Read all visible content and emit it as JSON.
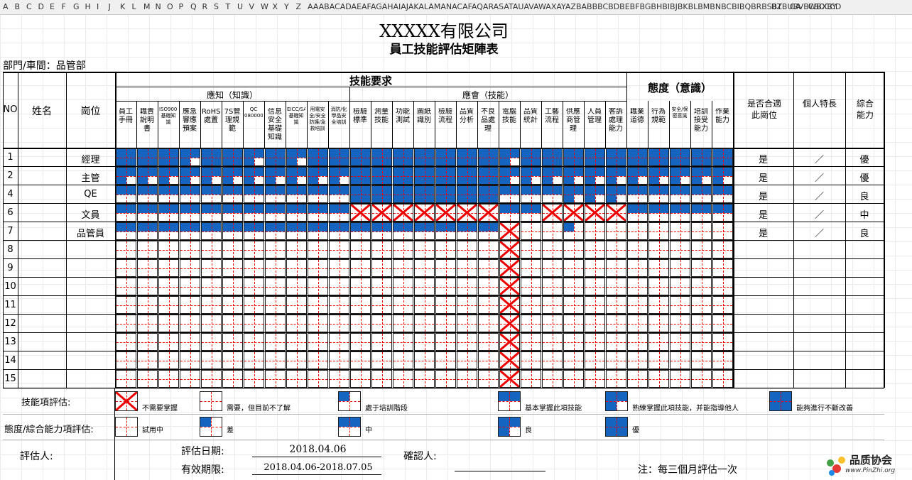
{
  "column_headers": [
    "A",
    "B",
    "C",
    "D",
    "E",
    "F",
    "G",
    "H",
    "I",
    "J",
    "K",
    "L",
    "M",
    "N",
    "O",
    "P",
    "Q",
    "R",
    "S",
    "T",
    "U",
    "V",
    "W",
    "X",
    "Y",
    "Z",
    "AAABACADAEAFAGAHAIAJAKALAMANACAFAQARASATAUAVAWAXAYAZBABBBCBDBEBFBGBHBIBJBKBLBMBNBCBIBQBRBSBTBUBVBWBXBY",
    "BZ",
    "CA",
    "CBCCCD"
  ],
  "company": "XXXXX有限公司",
  "form_title": "員工技能評估矩陣表",
  "department": "部門/車間：品管部",
  "headers": {
    "skills": "技能要求",
    "knowledge": "應知（知識）",
    "ability": "應會（技能）",
    "attitude": "態度（意識）",
    "no": "NO",
    "name": "姓名",
    "position": "崗位",
    "suitable": "是否合適此崗位",
    "specialty": "個人特長",
    "overall": "綜合能力"
  },
  "skill_columns": [
    {
      "label": "員工手冊",
      "small": false
    },
    {
      "label": "職責說明書",
      "small": false
    },
    {
      "label": "ISO9001/ISO14001基礎知識",
      "small": true
    },
    {
      "label": "應急響應預案",
      "small": false
    },
    {
      "label": "RoHS/處置",
      "small": false
    },
    {
      "label": "7S管理規範",
      "small": false
    },
    {
      "label": "QC 080000",
      "small": true
    },
    {
      "label": "信息安全基礎知識",
      "small": false
    },
    {
      "label": "EICC/SA8000基礎知識",
      "small": true
    },
    {
      "label": "用電安全/安全防護/急救培訓",
      "small": true
    },
    {
      "label": "消防/化學品安全培訓",
      "small": true
    },
    {
      "label": "檢驗標準",
      "small": false
    },
    {
      "label": "測量技能",
      "small": false
    },
    {
      "label": "功能測試",
      "small": false
    },
    {
      "label": "圖紙識別",
      "small": false
    },
    {
      "label": "檢驗流程",
      "small": false
    },
    {
      "label": "品質分析",
      "small": false
    },
    {
      "label": "不良品處理",
      "small": false
    },
    {
      "label": "電腦技能",
      "small": false
    },
    {
      "label": "品質統計",
      "small": false
    },
    {
      "label": "工藝流程",
      "small": false
    },
    {
      "label": "供應商管理",
      "small": false
    },
    {
      "label": "人員管理",
      "small": false
    },
    {
      "label": "客訴處理能力",
      "small": false
    },
    {
      "label": "職業道德",
      "small": false
    },
    {
      "label": "行為規範",
      "small": false
    },
    {
      "label": "安全/保密意識",
      "small": true
    },
    {
      "label": "培訓接受能力",
      "small": false
    },
    {
      "label": "作業能力",
      "small": false
    }
  ],
  "rows": [
    {
      "no": "1",
      "position": "經理",
      "suitable": "是",
      "specialty": "／",
      "overall": "優",
      "levels": [
        4,
        4,
        4,
        3,
        4,
        4,
        3,
        4,
        3,
        4,
        4,
        4,
        4,
        4,
        4,
        4,
        4,
        4,
        3,
        4,
        4,
        4,
        4,
        4,
        4,
        4,
        4,
        4,
        4
      ]
    },
    {
      "no": "2",
      "position": "主管",
      "suitable": "是",
      "specialty": "／",
      "overall": "優",
      "levels": [
        3,
        3,
        3,
        3,
        3,
        3,
        3,
        3,
        3,
        3,
        3,
        4,
        4,
        4,
        4,
        4,
        4,
        4,
        3,
        3,
        3,
        3,
        3,
        3,
        3,
        3,
        3,
        3,
        3
      ]
    },
    {
      "no": "4",
      "position": "QE",
      "suitable": "是",
      "specialty": "／",
      "overall": "良",
      "levels": [
        2,
        2,
        2,
        2,
        2,
        2,
        2,
        2,
        2,
        2,
        2,
        4,
        4,
        4,
        4,
        4,
        4,
        4,
        2,
        2,
        2,
        3,
        3,
        3,
        2,
        2,
        2,
        2,
        2
      ]
    },
    {
      "no": "6",
      "position": "文員",
      "suitable": "是",
      "specialty": "／",
      "overall": "中",
      "levels": [
        2,
        2,
        2,
        2,
        2,
        2,
        2,
        2,
        2,
        2,
        2,
        -1,
        -1,
        -1,
        -1,
        -1,
        -1,
        -1,
        2,
        2,
        -1,
        -1,
        -1,
        -1,
        2,
        2,
        2,
        2,
        2
      ]
    },
    {
      "no": "7",
      "position": "品管員",
      "suitable": "是",
      "specialty": "／",
      "overall": "良",
      "levels": [
        2,
        2,
        2,
        2,
        2,
        2,
        2,
        2,
        2,
        2,
        2,
        2,
        2,
        2,
        2,
        2,
        2,
        2,
        -1,
        0,
        0,
        1,
        0,
        0,
        0,
        0,
        0,
        0,
        0
      ]
    },
    {
      "no": "8",
      "position": "",
      "suitable": "",
      "specialty": "",
      "overall": "",
      "levels": [
        0,
        0,
        0,
        0,
        0,
        0,
        0,
        0,
        0,
        0,
        0,
        0,
        0,
        0,
        0,
        0,
        0,
        0,
        -1,
        0,
        0,
        0,
        0,
        0,
        0,
        0,
        0,
        0,
        0
      ]
    },
    {
      "no": "9",
      "position": "",
      "suitable": "",
      "specialty": "",
      "overall": "",
      "levels": [
        0,
        0,
        0,
        0,
        0,
        0,
        0,
        0,
        0,
        0,
        0,
        0,
        0,
        0,
        0,
        0,
        0,
        0,
        -1,
        0,
        0,
        0,
        0,
        0,
        0,
        0,
        0,
        0,
        0
      ]
    },
    {
      "no": "10",
      "position": "",
      "suitable": "",
      "specialty": "",
      "overall": "",
      "levels": [
        0,
        0,
        0,
        0,
        0,
        0,
        0,
        0,
        0,
        0,
        0,
        0,
        0,
        0,
        0,
        0,
        0,
        0,
        -1,
        0,
        0,
        0,
        0,
        0,
        0,
        0,
        0,
        0,
        0
      ]
    },
    {
      "no": "11",
      "position": "",
      "suitable": "",
      "specialty": "",
      "overall": "",
      "levels": [
        0,
        0,
        0,
        0,
        0,
        0,
        0,
        0,
        0,
        0,
        0,
        0,
        0,
        0,
        0,
        0,
        0,
        0,
        -1,
        0,
        0,
        0,
        0,
        0,
        0,
        0,
        0,
        0,
        0
      ]
    },
    {
      "no": "12",
      "position": "",
      "suitable": "",
      "specialty": "",
      "overall": "",
      "levels": [
        0,
        0,
        0,
        0,
        0,
        0,
        0,
        0,
        0,
        0,
        0,
        0,
        0,
        0,
        0,
        0,
        0,
        0,
        -1,
        0,
        0,
        0,
        0,
        0,
        0,
        0,
        0,
        0,
        0
      ]
    },
    {
      "no": "13",
      "position": "",
      "suitable": "",
      "specialty": "",
      "overall": "",
      "levels": [
        0,
        0,
        0,
        0,
        0,
        0,
        0,
        0,
        0,
        0,
        0,
        0,
        0,
        0,
        0,
        0,
        0,
        0,
        -1,
        0,
        0,
        0,
        0,
        0,
        0,
        0,
        0,
        0,
        0
      ]
    },
    {
      "no": "14",
      "position": "",
      "suitable": "",
      "specialty": "",
      "overall": "",
      "levels": [
        0,
        0,
        0,
        0,
        0,
        0,
        0,
        0,
        0,
        0,
        0,
        0,
        0,
        0,
        0,
        0,
        0,
        0,
        -1,
        0,
        0,
        0,
        0,
        0,
        0,
        0,
        0,
        0,
        0
      ]
    },
    {
      "no": "15",
      "position": "",
      "suitable": "",
      "specialty": "",
      "overall": "",
      "levels": [
        0,
        0,
        0,
        0,
        0,
        0,
        0,
        0,
        0,
        0,
        0,
        0,
        0,
        0,
        0,
        0,
        0,
        0,
        -1,
        0,
        0,
        0,
        0,
        0,
        0,
        0,
        0,
        0,
        0
      ]
    }
  ],
  "legend_skill": {
    "label": "技能項評估:",
    "items": [
      {
        "level": -1,
        "text": "不需要掌握"
      },
      {
        "level": 0,
        "text": "需要，但目前不了解"
      },
      {
        "level": 1,
        "text": "處于培訓階段"
      },
      {
        "level": 2,
        "text": "基本掌握此項技能"
      },
      {
        "level": 3,
        "text": "熟練掌握此項技能，并能指導他人"
      },
      {
        "level": 4,
        "text": "能夠進行不斷改善"
      }
    ]
  },
  "legend_attitude": {
    "label": "態度/綜合能力項評估:",
    "items": [
      {
        "level": 0,
        "text": "試用中"
      },
      {
        "level": 1,
        "text": "差"
      },
      {
        "level": 2,
        "text": "中"
      },
      {
        "level": 3,
        "text": "良"
      },
      {
        "level": 4,
        "text": "優"
      }
    ]
  },
  "footer": {
    "assessor_label": "評估人:",
    "date_label": "評估日期:",
    "date_value": "2018.04.06",
    "confirm_label": "確認人:",
    "validity_label": "有效期限:",
    "validity_value": "2018.04.06-2018.07.05",
    "note": "注：每三個月評估一次"
  },
  "logo": {
    "cn": "品质协会",
    "url": "www.PinZhi.org"
  },
  "colors": {
    "fill": "#1565c0",
    "dash": "#e00000"
  }
}
